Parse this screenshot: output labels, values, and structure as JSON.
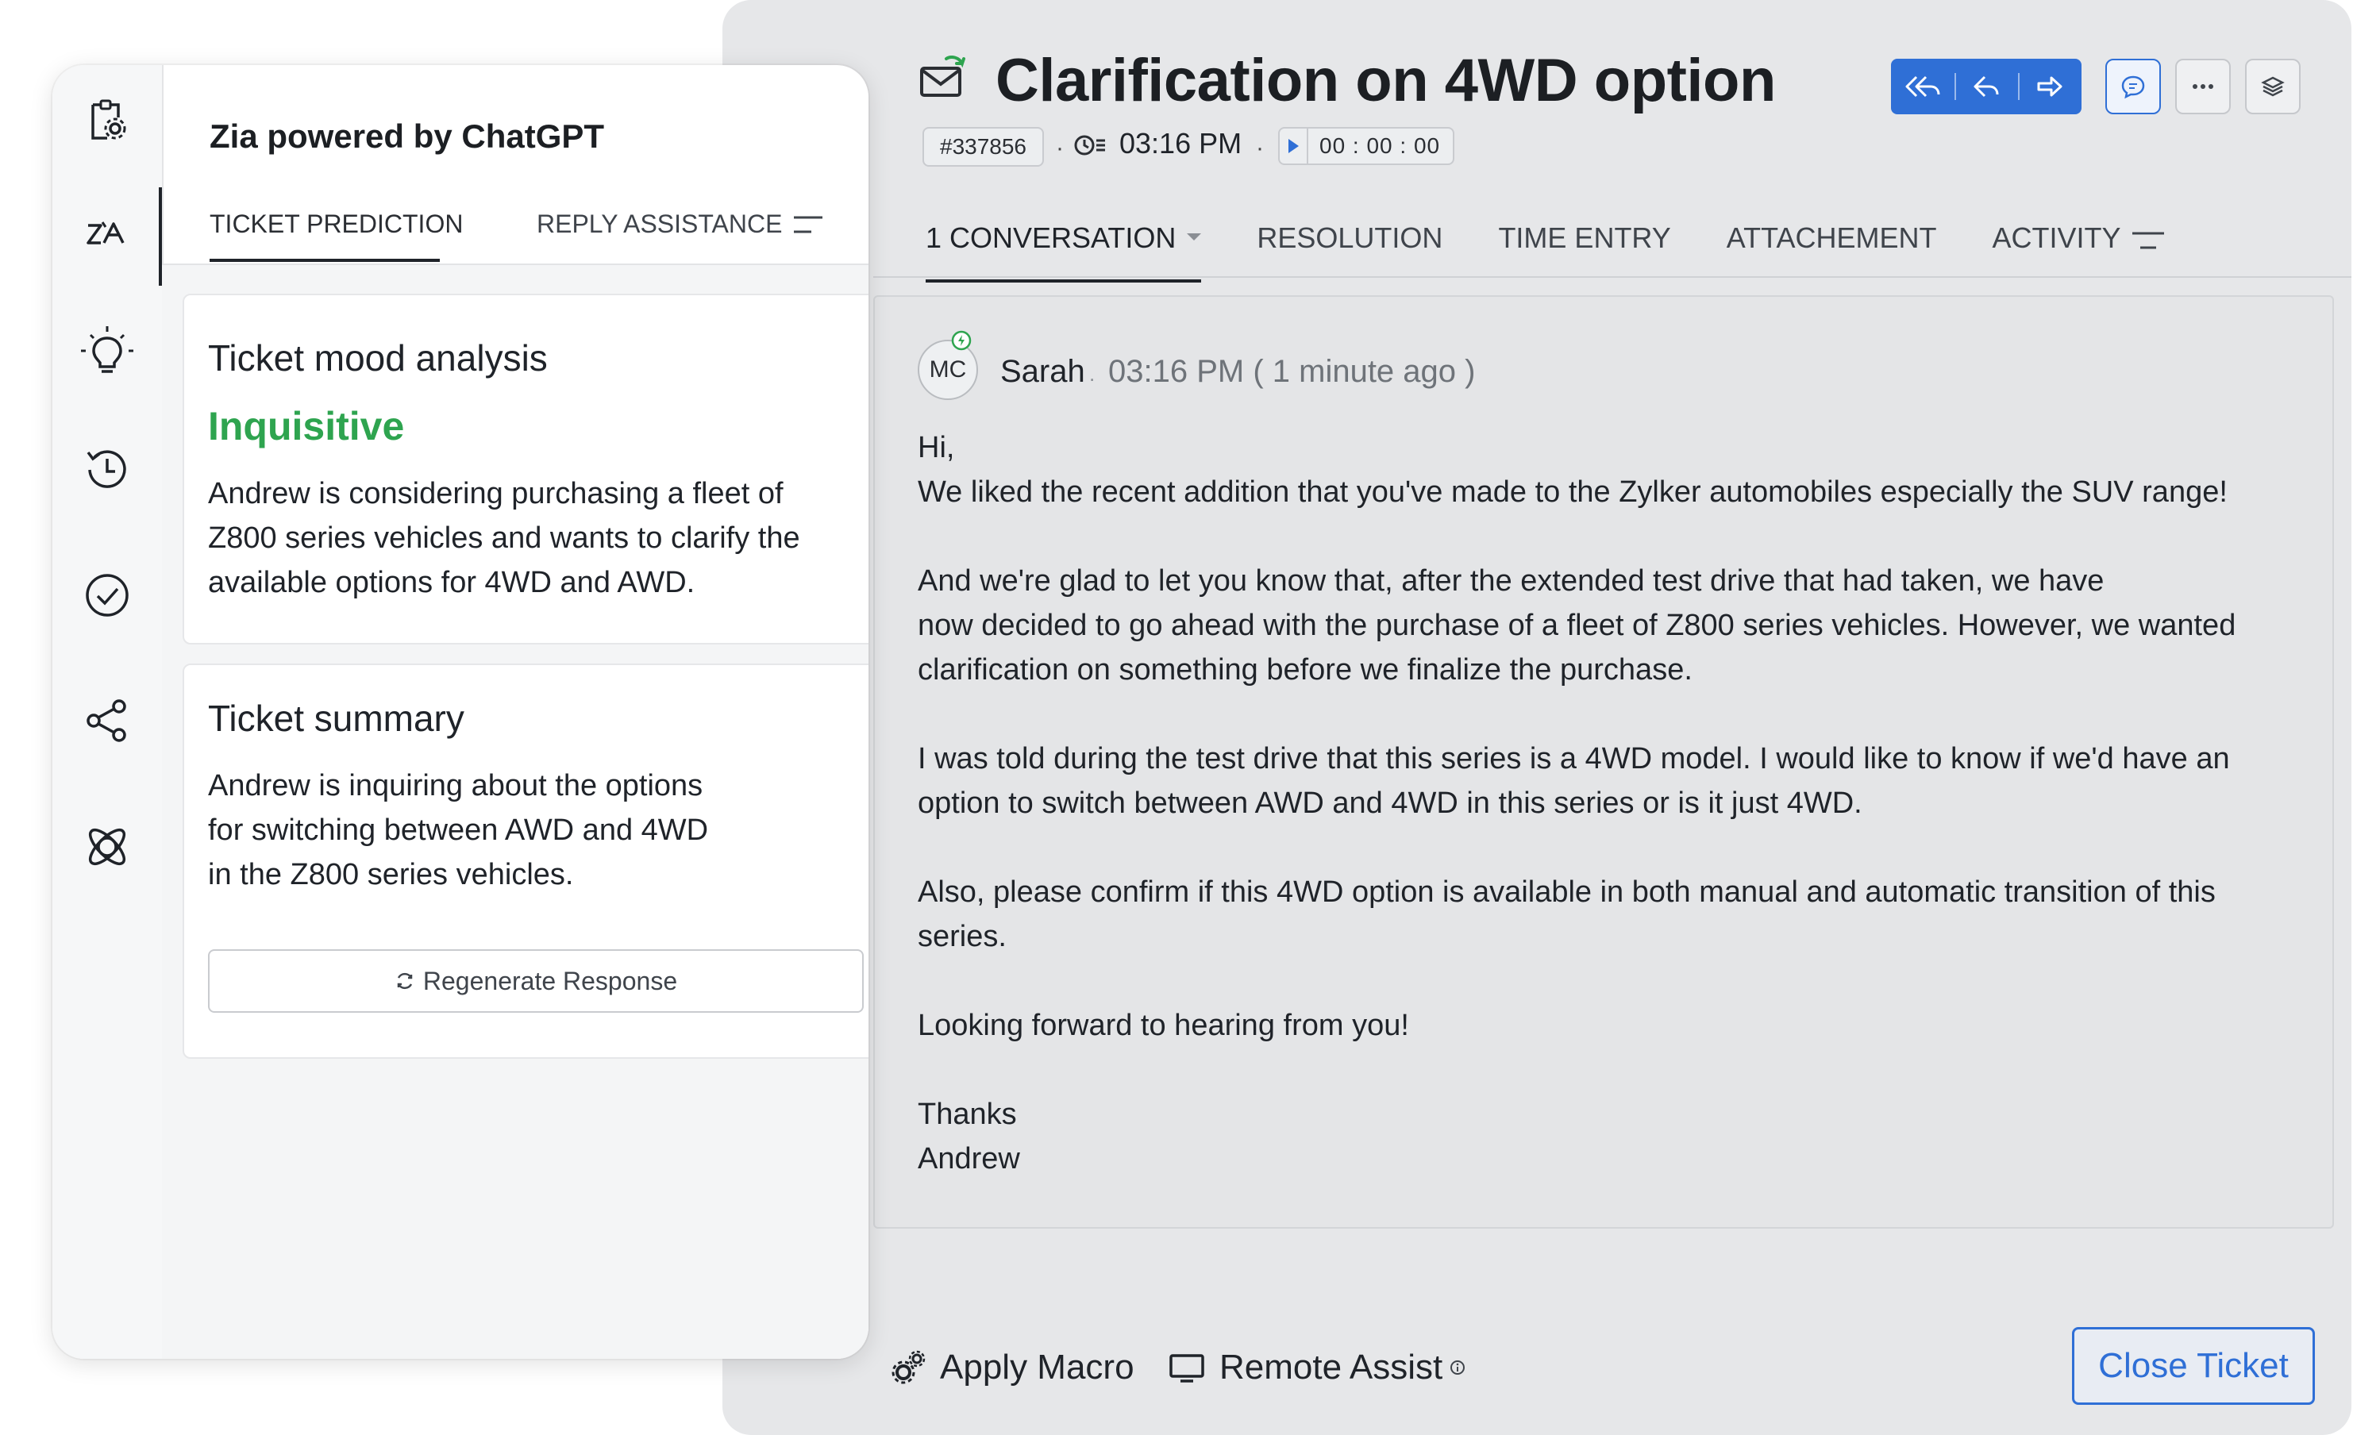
{
  "ticket": {
    "title": "Clarification on 4WD option",
    "id": "#337856",
    "time": "03:16 PM",
    "timer": "00 : 00 : 00",
    "tabs": [
      {
        "label": "1 CONVERSATION"
      },
      {
        "label": "RESOLUTION"
      },
      {
        "label": "TIME ENTRY"
      },
      {
        "label": "ATTACHEMENT"
      },
      {
        "label": "ACTIVITY"
      }
    ],
    "message": {
      "avatar_initials": "MC",
      "sender": "Sarah",
      "timestamp": "03:16 PM ( 1 minute ago )",
      "lines": [
        "Hi,",
        "We liked the recent addition that you've made to the Zylker automobiles especially the SUV range!",
        "And we're glad to let you know that, after the extended test drive that had taken, we have",
        "now decided to go ahead with the purchase of a fleet of Z800 series vehicles. However, we wanted",
        "clarification on something before we finalize the purchase.",
        "I was told during the test drive that this series is a 4WD model. I would like to know if we'd have an",
        "option to switch between AWD and 4WD in this series or is it just 4WD.",
        "Also, please confirm if this 4WD option is available in both manual and automatic transition of this",
        "series.",
        "Looking forward to hearing from you!",
        "Thanks",
        "Andrew"
      ]
    },
    "footer": {
      "apply_macro": "Apply Macro",
      "remote_assist": "Remote Assist",
      "close_ticket": "Close Ticket"
    }
  },
  "zia": {
    "title": "Zia powered by ChatGPT",
    "tabs": [
      "TICKET PREDICTION",
      "REPLY ASSISTANCE"
    ],
    "mood_card": {
      "title": "Ticket mood analysis",
      "mood": "Inquisitive",
      "lines": [
        "Andrew is considering purchasing a fleet of",
        "Z800 series vehicles and wants to clarify the",
        "available options for 4WD and AWD."
      ]
    },
    "summary_card": {
      "title": "Ticket summary",
      "lines": [
        "Andrew is inquiring about the options",
        "for switching between AWD and 4WD",
        "in the Z800 series vehicles."
      ],
      "regenerate_label": "Regenerate Response"
    },
    "rail_icons": [
      "ticket-settings-icon",
      "zia-icon",
      "bulb-icon",
      "history-icon",
      "check-circle-icon",
      "share-icon",
      "atom-icon"
    ]
  },
  "colors": {
    "accent": "#2f6fd6",
    "mood": "#2ea44f",
    "panel_bg": "#e6e7e9"
  }
}
